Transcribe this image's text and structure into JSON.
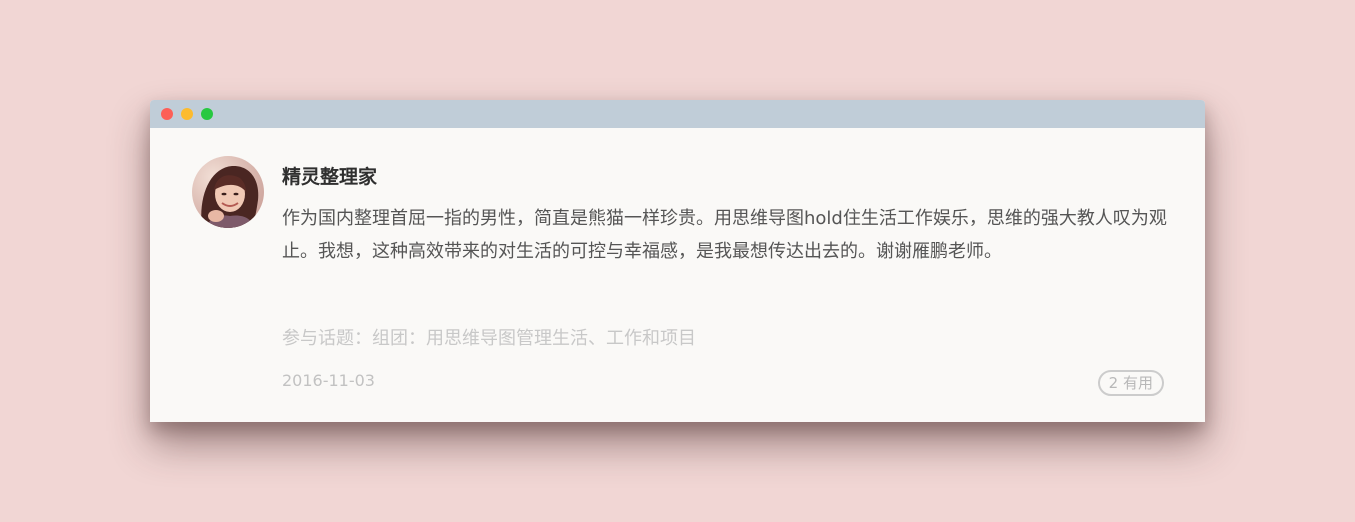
{
  "colors": {
    "background": "#f1d6d4",
    "titlebar": "#c0cdd8",
    "window": "#faf9f7",
    "close_dot": "#fd5f57",
    "minimize_dot": "#fdbb2e",
    "maximize_dot": "#27c840"
  },
  "comment": {
    "author": "精灵整理家",
    "text": "作为国内整理首屈一指的男性，简直是熊猫一样珍贵。用思维导图hold住生活工作娱乐，思维的强大教人叹为观止。我想，这种高效带来的对生活的可控与幸福感，是我最想传达出去的。谢谢雁鹏老师。",
    "topic": "参与话题：组团：用思维导图管理生活、工作和项目",
    "date": "2016-11-03",
    "useful_count": "2",
    "useful_label": "有用"
  },
  "icons": {
    "avatar": "user-avatar-photo"
  }
}
